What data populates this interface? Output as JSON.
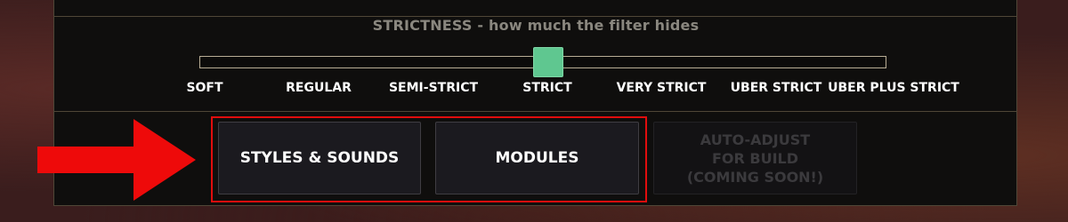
{
  "strictness": {
    "title": "STRICTNESS - how much the filter hides",
    "levels": [
      "SOFT",
      "REGULAR",
      "SEMI-STRICT",
      "STRICT",
      "VERY STRICT",
      "UBER STRICT",
      "UBER PLUS STRICT"
    ],
    "selected_index": 3,
    "selected_label": "STRICT"
  },
  "buttons": {
    "styles_sounds": "STYLES & SOUNDS",
    "modules": "MODULES",
    "auto_adjust": "AUTO-ADJUST\nFOR BUILD\n(COMING SOON!)",
    "auto_adjust_enabled": false
  },
  "annotation": {
    "arrow_icon": "right-arrow-icon",
    "highlight_color": "#e00d0d"
  },
  "colors": {
    "slider_thumb": "#5fc790",
    "panel_bg": "#0f0e0d",
    "panel_border": "#4f4637"
  }
}
